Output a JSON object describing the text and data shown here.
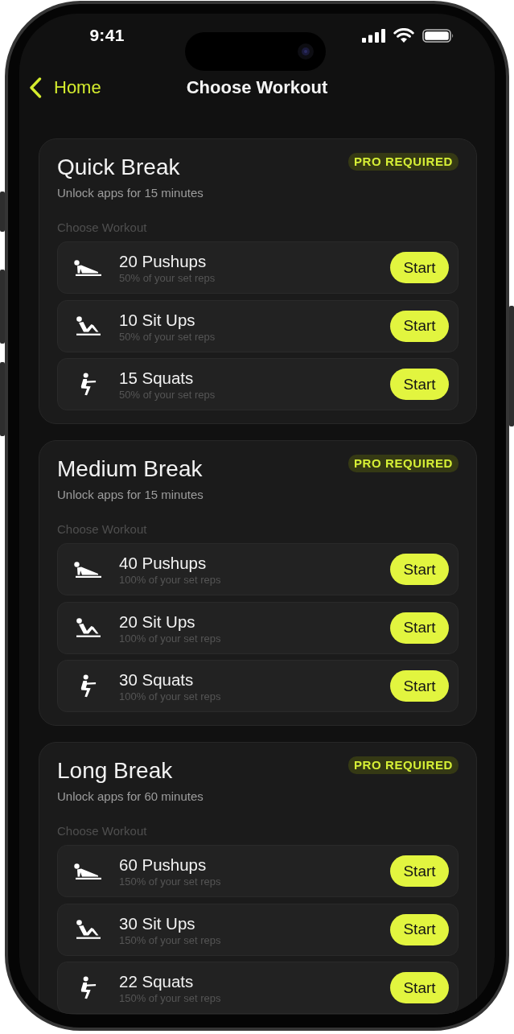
{
  "status_bar": {
    "time": "9:41"
  },
  "nav": {
    "back_label": "Home",
    "title": "Choose Workout"
  },
  "sections": [
    {
      "title": "Quick Break",
      "badge": "PRO REQUIRED",
      "subtitle": "Unlock apps for 15 minutes",
      "list_label": "Choose Workout",
      "workouts": [
        {
          "kind": "pushups",
          "name": "20 Pushups",
          "detail": "50% of your set reps",
          "action": "Start"
        },
        {
          "kind": "situps",
          "name": "10 Sit Ups",
          "detail": "50% of your set reps",
          "action": "Start"
        },
        {
          "kind": "squats",
          "name": "15 Squats",
          "detail": "50% of your set reps",
          "action": "Start"
        }
      ]
    },
    {
      "title": "Medium Break",
      "badge": "PRO REQUIRED",
      "subtitle": "Unlock apps for 15 minutes",
      "list_label": "Choose Workout",
      "workouts": [
        {
          "kind": "pushups",
          "name": "40 Pushups",
          "detail": "100% of your set reps",
          "action": "Start"
        },
        {
          "kind": "situps",
          "name": "20 Sit Ups",
          "detail": "100% of your set reps",
          "action": "Start"
        },
        {
          "kind": "squats",
          "name": "30 Squats",
          "detail": "100% of your set reps",
          "action": "Start"
        }
      ]
    },
    {
      "title": "Long Break",
      "badge": "PRO REQUIRED",
      "subtitle": "Unlock apps for 60 minutes",
      "list_label": "Choose Workout",
      "workouts": [
        {
          "kind": "pushups",
          "name": "60 Pushups",
          "detail": "150% of your set reps",
          "action": "Start"
        },
        {
          "kind": "situps",
          "name": "30 Sit Ups",
          "detail": "150% of your set reps",
          "action": "Start"
        },
        {
          "kind": "squats",
          "name": "22 Squats",
          "detail": "150% of your set reps",
          "action": "Start"
        }
      ]
    }
  ]
}
